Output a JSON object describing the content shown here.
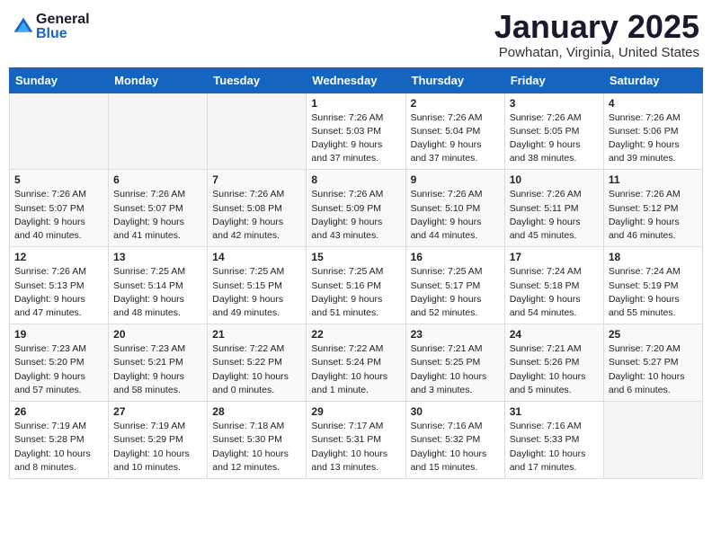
{
  "logo": {
    "general": "General",
    "blue": "Blue"
  },
  "title": "January 2025",
  "location": "Powhatan, Virginia, United States",
  "days_of_week": [
    "Sunday",
    "Monday",
    "Tuesday",
    "Wednesday",
    "Thursday",
    "Friday",
    "Saturday"
  ],
  "weeks": [
    [
      {
        "day": "",
        "info": ""
      },
      {
        "day": "",
        "info": ""
      },
      {
        "day": "",
        "info": ""
      },
      {
        "day": "1",
        "info": "Sunrise: 7:26 AM\nSunset: 5:03 PM\nDaylight: 9 hours\nand 37 minutes."
      },
      {
        "day": "2",
        "info": "Sunrise: 7:26 AM\nSunset: 5:04 PM\nDaylight: 9 hours\nand 37 minutes."
      },
      {
        "day": "3",
        "info": "Sunrise: 7:26 AM\nSunset: 5:05 PM\nDaylight: 9 hours\nand 38 minutes."
      },
      {
        "day": "4",
        "info": "Sunrise: 7:26 AM\nSunset: 5:06 PM\nDaylight: 9 hours\nand 39 minutes."
      }
    ],
    [
      {
        "day": "5",
        "info": "Sunrise: 7:26 AM\nSunset: 5:07 PM\nDaylight: 9 hours\nand 40 minutes."
      },
      {
        "day": "6",
        "info": "Sunrise: 7:26 AM\nSunset: 5:07 PM\nDaylight: 9 hours\nand 41 minutes."
      },
      {
        "day": "7",
        "info": "Sunrise: 7:26 AM\nSunset: 5:08 PM\nDaylight: 9 hours\nand 42 minutes."
      },
      {
        "day": "8",
        "info": "Sunrise: 7:26 AM\nSunset: 5:09 PM\nDaylight: 9 hours\nand 43 minutes."
      },
      {
        "day": "9",
        "info": "Sunrise: 7:26 AM\nSunset: 5:10 PM\nDaylight: 9 hours\nand 44 minutes."
      },
      {
        "day": "10",
        "info": "Sunrise: 7:26 AM\nSunset: 5:11 PM\nDaylight: 9 hours\nand 45 minutes."
      },
      {
        "day": "11",
        "info": "Sunrise: 7:26 AM\nSunset: 5:12 PM\nDaylight: 9 hours\nand 46 minutes."
      }
    ],
    [
      {
        "day": "12",
        "info": "Sunrise: 7:26 AM\nSunset: 5:13 PM\nDaylight: 9 hours\nand 47 minutes."
      },
      {
        "day": "13",
        "info": "Sunrise: 7:25 AM\nSunset: 5:14 PM\nDaylight: 9 hours\nand 48 minutes."
      },
      {
        "day": "14",
        "info": "Sunrise: 7:25 AM\nSunset: 5:15 PM\nDaylight: 9 hours\nand 49 minutes."
      },
      {
        "day": "15",
        "info": "Sunrise: 7:25 AM\nSunset: 5:16 PM\nDaylight: 9 hours\nand 51 minutes."
      },
      {
        "day": "16",
        "info": "Sunrise: 7:25 AM\nSunset: 5:17 PM\nDaylight: 9 hours\nand 52 minutes."
      },
      {
        "day": "17",
        "info": "Sunrise: 7:24 AM\nSunset: 5:18 PM\nDaylight: 9 hours\nand 54 minutes."
      },
      {
        "day": "18",
        "info": "Sunrise: 7:24 AM\nSunset: 5:19 PM\nDaylight: 9 hours\nand 55 minutes."
      }
    ],
    [
      {
        "day": "19",
        "info": "Sunrise: 7:23 AM\nSunset: 5:20 PM\nDaylight: 9 hours\nand 57 minutes."
      },
      {
        "day": "20",
        "info": "Sunrise: 7:23 AM\nSunset: 5:21 PM\nDaylight: 9 hours\nand 58 minutes."
      },
      {
        "day": "21",
        "info": "Sunrise: 7:22 AM\nSunset: 5:22 PM\nDaylight: 10 hours\nand 0 minutes."
      },
      {
        "day": "22",
        "info": "Sunrise: 7:22 AM\nSunset: 5:24 PM\nDaylight: 10 hours\nand 1 minute."
      },
      {
        "day": "23",
        "info": "Sunrise: 7:21 AM\nSunset: 5:25 PM\nDaylight: 10 hours\nand 3 minutes."
      },
      {
        "day": "24",
        "info": "Sunrise: 7:21 AM\nSunset: 5:26 PM\nDaylight: 10 hours\nand 5 minutes."
      },
      {
        "day": "25",
        "info": "Sunrise: 7:20 AM\nSunset: 5:27 PM\nDaylight: 10 hours\nand 6 minutes."
      }
    ],
    [
      {
        "day": "26",
        "info": "Sunrise: 7:19 AM\nSunset: 5:28 PM\nDaylight: 10 hours\nand 8 minutes."
      },
      {
        "day": "27",
        "info": "Sunrise: 7:19 AM\nSunset: 5:29 PM\nDaylight: 10 hours\nand 10 minutes."
      },
      {
        "day": "28",
        "info": "Sunrise: 7:18 AM\nSunset: 5:30 PM\nDaylight: 10 hours\nand 12 minutes."
      },
      {
        "day": "29",
        "info": "Sunrise: 7:17 AM\nSunset: 5:31 PM\nDaylight: 10 hours\nand 13 minutes."
      },
      {
        "day": "30",
        "info": "Sunrise: 7:16 AM\nSunset: 5:32 PM\nDaylight: 10 hours\nand 15 minutes."
      },
      {
        "day": "31",
        "info": "Sunrise: 7:16 AM\nSunset: 5:33 PM\nDaylight: 10 hours\nand 17 minutes."
      },
      {
        "day": "",
        "info": ""
      }
    ]
  ]
}
